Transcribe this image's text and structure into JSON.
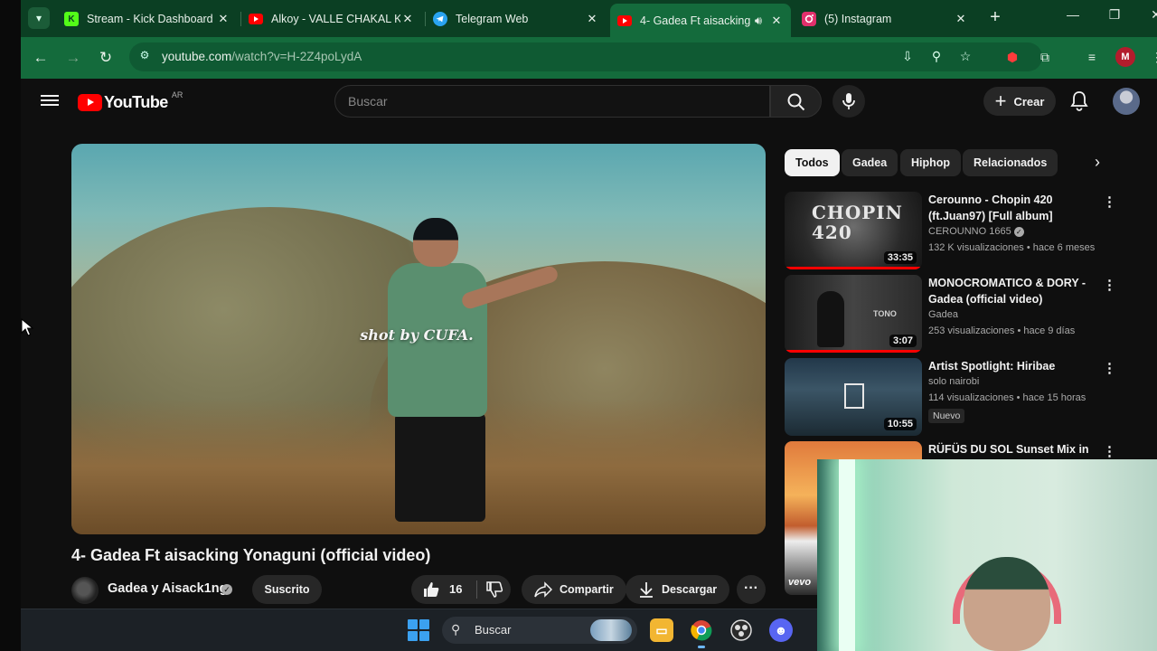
{
  "browser": {
    "tabs": [
      {
        "title": "Stream - Kick Dashboard",
        "favicon": "kick-icon",
        "color": "#53fc18",
        "active": false
      },
      {
        "title": "Alkoy - VALLE CHAKAL K",
        "favicon": "youtube-icon",
        "color": "#ff0000",
        "active": false
      },
      {
        "title": "Telegram Web",
        "favicon": "telegram-icon",
        "color": "#2aa3ef",
        "active": false
      },
      {
        "title": "4- Gadea Ft aisacking",
        "favicon": "youtube-icon",
        "color": "#ff0000",
        "active": true
      },
      {
        "title": "(5) Instagram",
        "favicon": "instagram-icon",
        "color": "#e1306c",
        "active": false
      }
    ],
    "url_host": "youtube.com",
    "url_path": "/watch?v=H-2Z4poLydA",
    "profile_initial": "M",
    "theme_color": "#146b3c"
  },
  "youtube": {
    "logo_text": "YouTube",
    "country_code": "AR",
    "search_placeholder": "Buscar",
    "create_label": "Crear"
  },
  "video": {
    "overlay_caption": "shot by CUFA.",
    "title": "4- Gadea Ft aisacking Yonaguni (official video)",
    "channel": "Gadea y Aisack1ng",
    "subscribe_label": "Suscrito",
    "likes": "16",
    "share_label": "Compartir",
    "download_label": "Descargar"
  },
  "chips": [
    "Todos",
    "Gadea",
    "Hiphop",
    "Relacionados"
  ],
  "recommendations": [
    {
      "title": "Cerounno - Chopin 420 (ft.Juan97) [Full album]",
      "channel": "CEROUNNO 1665",
      "verified": true,
      "meta": "132 K visualizaciones • hace 6 meses",
      "duration": "33:35",
      "badge": "",
      "watched": true
    },
    {
      "title": "MONOCROMATICO & DORY - Gadea (official video)",
      "channel": "Gadea",
      "verified": false,
      "meta": "253 visualizaciones • hace 9 días",
      "duration": "3:07",
      "badge": "",
      "watched": true
    },
    {
      "title": "Artist Spotlight: Hiribae",
      "channel": "solo nairobi",
      "verified": false,
      "meta": "114 visualizaciones • hace 15 horas",
      "duration": "10:55",
      "badge": "Nuevo",
      "watched": false
    },
    {
      "title": "RÜFÜS DU SOL Sunset Mix in",
      "channel": "",
      "verified": false,
      "meta": "",
      "duration": "",
      "badge": "",
      "watched": false
    }
  ],
  "thumb_texts": {
    "chopin": "CHOPIN 420",
    "tono": "TONO",
    "vevo": "vevo"
  },
  "taskbar": {
    "search_label": "Buscar"
  }
}
